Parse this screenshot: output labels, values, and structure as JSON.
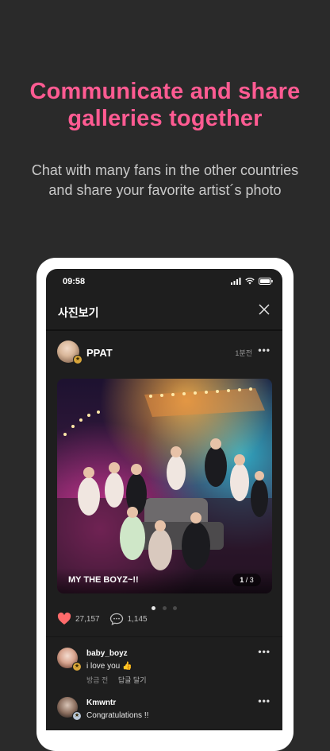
{
  "promo": {
    "headline_line1": "Communicate and share",
    "headline_line2": "galleries together",
    "sub_line1": "Chat with many fans in the other countries",
    "sub_line2": "and share your favorite artist´s photo"
  },
  "status_bar": {
    "time": "09:58"
  },
  "top_bar": {
    "title": "사진보기",
    "close_icon": "close-icon"
  },
  "post": {
    "author": "PPAT",
    "time_ago": "1분전",
    "photo_caption": "MY THE BOYZ~!!",
    "photo_index": "1",
    "photo_total": "/ 3",
    "carousel_pages": 3,
    "carousel_active": 1,
    "likes": "27,157",
    "comments": "1,145"
  },
  "comments": [
    {
      "name": "baby_boyz",
      "text": "i love you",
      "time": "방금 전",
      "reply": "답글 달기"
    },
    {
      "name": "Kmwntr",
      "text": "Congratulations !!"
    }
  ],
  "colors": {
    "accent": "#ff5b92",
    "background": "#2a2a2a",
    "like": "#ff6b6b"
  }
}
